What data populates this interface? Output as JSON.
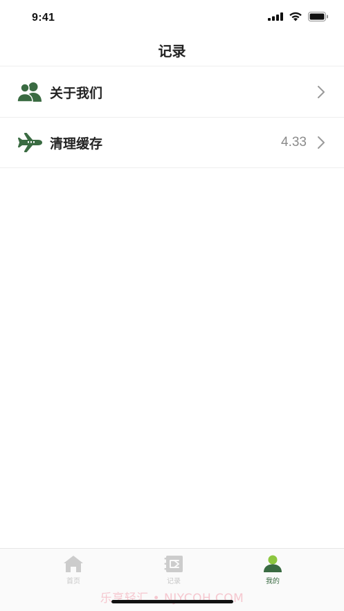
{
  "status_bar": {
    "time": "9:41",
    "icons": [
      "signal-icon",
      "wifi-icon",
      "battery-icon"
    ]
  },
  "nav": {
    "title": "记录"
  },
  "list": {
    "items": [
      {
        "label": "关于我们",
        "icon": "users-icon",
        "value": ""
      },
      {
        "label": "清理缓存",
        "icon": "airplane-icon",
        "value": "4.33"
      }
    ]
  },
  "tab_bar": {
    "tabs": [
      {
        "label": "首页",
        "icon": "home-icon",
        "active": false
      },
      {
        "label": "记录",
        "icon": "notebook-icon",
        "active": false
      },
      {
        "label": "我的",
        "icon": "profile-icon",
        "active": true
      }
    ]
  },
  "colors": {
    "accent": "#3a6b42",
    "accent_light": "#8cc63f",
    "inactive": "#cccccc",
    "value_text": "#8a8a8a"
  },
  "watermark": "乐享轻汇 • NJYCQH.COM"
}
